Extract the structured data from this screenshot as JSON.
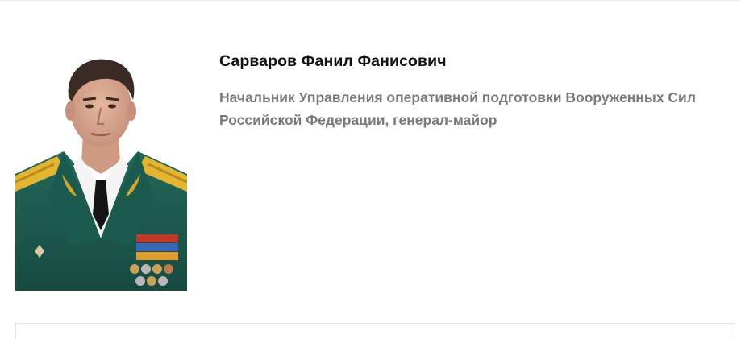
{
  "person": {
    "name": "Сарваров Фанил Фанисович",
    "position": "Начальник Управления оперативной подготовки Вооруженных Сил Российской Федерации, генерал-майор",
    "photo_alt": "Сарваров Фанил Фанисович"
  },
  "colors": {
    "name_text": "#111111",
    "position_text": "#7a7a7a",
    "uniform_green": "#1f5a50",
    "background": "#ffffff"
  }
}
